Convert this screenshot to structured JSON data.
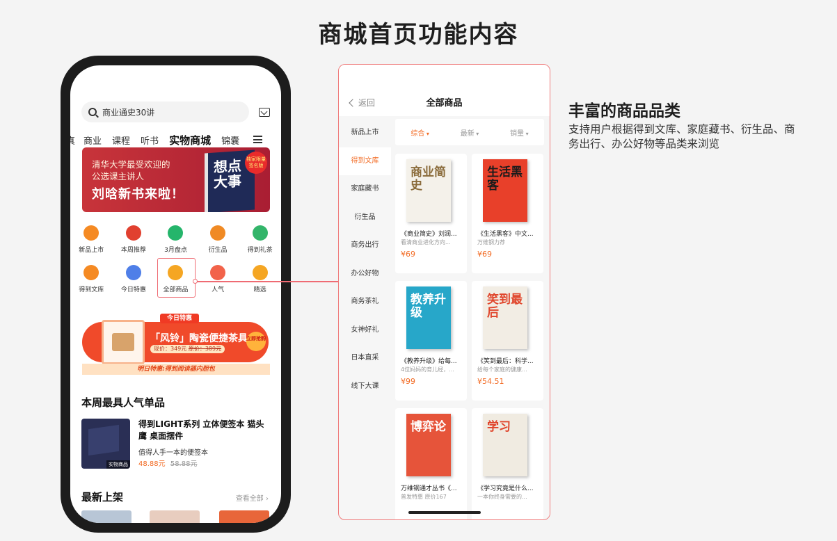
{
  "page_title": "商城首页功能内容",
  "phone": {
    "search": {
      "placeholder": "商业通史30讲"
    },
    "tabs": [
      {
        "label": "真"
      },
      {
        "label": "商业"
      },
      {
        "label": "课程"
      },
      {
        "label": "听书"
      },
      {
        "label": "实物商城"
      },
      {
        "label": "锦囊"
      }
    ],
    "banner": {
      "line1": "清华大学最受欢迎的",
      "line2": "公选课主讲人",
      "line3": "刘晗新书来啦！",
      "book_title": "想点大事",
      "badge": "独家限量签名版"
    },
    "icons_row1": [
      {
        "label": "新品上市",
        "icon": "new-icon",
        "color": "#f58a23"
      },
      {
        "label": "本周推荐",
        "icon": "flame-icon",
        "color": "#e1402f"
      },
      {
        "label": "3月盘点",
        "icon": "calendar-icon",
        "color": "#25b56b"
      },
      {
        "label": "衍生品",
        "icon": "owl-icon",
        "color": "#f08a24"
      },
      {
        "label": "得到礼茶",
        "icon": "tea-icon",
        "color": "#33b56a"
      }
    ],
    "icons_row2": [
      {
        "label": "得到文库",
        "icon": "books-icon",
        "color": "#f58a23"
      },
      {
        "label": "今日特惠",
        "icon": "coupon-icon",
        "color": "#4f7fe8"
      },
      {
        "label": "全部商品",
        "icon": "grid-icon",
        "color": "#f5a623"
      },
      {
        "label": "人气",
        "icon": "heart-icon",
        "color": "#f2634a"
      },
      {
        "label": "精选",
        "icon": "diamond-icon",
        "color": "#f5a623"
      }
    ],
    "promo": {
      "tag": "今日特惠",
      "title": "「风铃」陶瓷便捷茶具",
      "price": "现价：349元",
      "old_price": "原价：389元",
      "button": "立即抢购",
      "footer": "明日特惠:得到阅读器内胆包"
    },
    "weekly": {
      "title": "本周最具人气单品",
      "product": {
        "name": "得到LIGHT系列 立体便签本 猫头鹰 桌面摆件",
        "subtitle": "值得人手一本的便签本",
        "price": "48.88元",
        "old_price": "58.88元",
        "badge": "实物商品"
      }
    },
    "new_arrivals": {
      "title": "最新上架",
      "see_all": "查看全部 ›"
    }
  },
  "panel": {
    "back_label": "返回",
    "title": "全部商品",
    "categories": [
      {
        "label": "新品上市"
      },
      {
        "label": "得到文库"
      },
      {
        "label": "家庭藏书"
      },
      {
        "label": "衍生品"
      },
      {
        "label": "商务出行"
      },
      {
        "label": "办公好物"
      },
      {
        "label": "商务茶礼"
      },
      {
        "label": "女神好礼"
      },
      {
        "label": "日本直采"
      },
      {
        "label": "线下大课"
      }
    ],
    "sorts": [
      {
        "label": "综合"
      },
      {
        "label": "最新"
      },
      {
        "label": "销量"
      }
    ],
    "products": [
      {
        "name": "《商业简史》刘润...",
        "sub": "看清商业进化方向...",
        "price": "¥69",
        "cover_text": "商业简史",
        "cover_color": "#f4f1ea",
        "cover_text_color": "#8a6b3a"
      },
      {
        "name": "《生活黑客》中文...",
        "sub": "万维钢力荐",
        "price": "¥69",
        "cover_text": "生活黑客",
        "cover_color": "#e8402a",
        "cover_text_color": "#1b1b1b"
      },
      {
        "name": "《教养升级》给每...",
        "sub": "4位妈妈的育儿经，...",
        "price": "¥99",
        "cover_text": "教养升级",
        "cover_color": "#27a7c9",
        "cover_text_color": "#ffffff"
      },
      {
        "name": "《笑到最后：科学...",
        "sub": "给每个家庭的健康...",
        "price": "¥54.51",
        "cover_text": "笑到最后",
        "cover_color": "#f2ede4",
        "cover_text_color": "#e0452b"
      },
      {
        "name": "万维钢通才丛书《...",
        "sub": "普发特惠 原价167",
        "price": "",
        "cover_text": "博弈论",
        "cover_color": "#e6543a",
        "cover_text_color": "#ffffff"
      },
      {
        "name": "《学习究竟是什么...",
        "sub": "一本你终身需要的...",
        "price": "",
        "cover_text": "学习",
        "cover_color": "#f0ebe1",
        "cover_text_color": "#e0452b"
      }
    ]
  },
  "feature": {
    "title": "丰富的商品品类",
    "description": "支持用户根据得到文库、家庭藏书、衍生品、商务出行、办公好物等品类来浏览"
  }
}
